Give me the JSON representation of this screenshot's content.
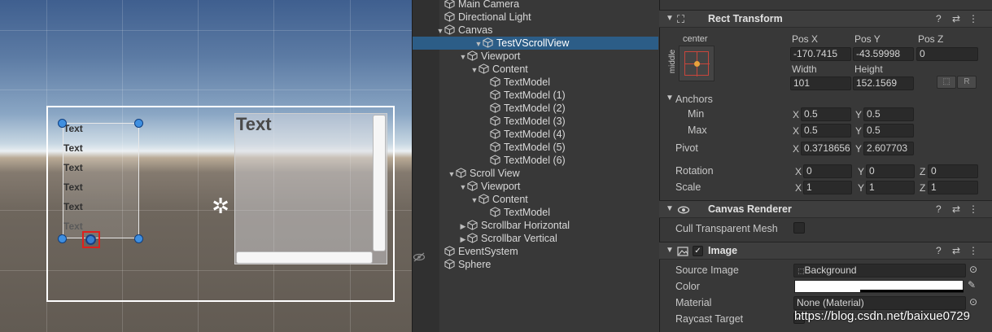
{
  "scene": {
    "sv1_texts": [
      "Text",
      "Text",
      "Text",
      "Text",
      "Text",
      "Text"
    ],
    "sv2_title": "Text"
  },
  "hierarchy": {
    "items": [
      {
        "label": "Main Camera",
        "arrow": ""
      },
      {
        "label": "Directional Light",
        "arrow": ""
      },
      {
        "label": "Canvas",
        "arrow": "▼"
      },
      {
        "label": "TestVScrollView",
        "arrow": "▼",
        "selected": true
      },
      {
        "label": "Viewport",
        "arrow": "▼"
      },
      {
        "label": "Content",
        "arrow": "▼"
      },
      {
        "label": "TextModel",
        "arrow": ""
      },
      {
        "label": "TextModel (1)",
        "arrow": ""
      },
      {
        "label": "TextModel (2)",
        "arrow": ""
      },
      {
        "label": "TextModel (3)",
        "arrow": ""
      },
      {
        "label": "TextModel (4)",
        "arrow": ""
      },
      {
        "label": "TextModel (5)",
        "arrow": ""
      },
      {
        "label": "TextModel (6)",
        "arrow": ""
      },
      {
        "label": "Scroll View",
        "arrow": "▼"
      },
      {
        "label": "Viewport",
        "arrow": "▼"
      },
      {
        "label": "Content",
        "arrow": "▼"
      },
      {
        "label": "TextModel",
        "arrow": ""
      },
      {
        "label": "Scrollbar Horizontal",
        "arrow": "▶"
      },
      {
        "label": "Scrollbar Vertical",
        "arrow": "▶"
      },
      {
        "label": "EventSystem",
        "arrow": ""
      },
      {
        "label": "Sphere",
        "arrow": ""
      }
    ]
  },
  "inspector": {
    "rect_transform": {
      "title": "Rect Transform",
      "anchor_preset_top": "center",
      "anchor_preset_side": "middle",
      "pos_x_label": "Pos X",
      "pos_y_label": "Pos Y",
      "pos_z_label": "Pos Z",
      "pos_x": "-170.7415",
      "pos_y": "-43.59998",
      "pos_z": "0",
      "width_label": "Width",
      "height_label": "Height",
      "width": "101",
      "height": "152.1569",
      "raw_btn": "R",
      "anchors_label": "Anchors",
      "min_label": "Min",
      "max_label": "Max",
      "x_label": "X",
      "y_label": "Y",
      "z_label": "Z",
      "min_x": "0.5",
      "min_y": "0.5",
      "max_x": "0.5",
      "max_y": "0.5",
      "pivot_label": "Pivot",
      "pivot_x": "0.3718656",
      "pivot_y": "2.607703",
      "rotation_label": "Rotation",
      "rot_x": "0",
      "rot_y": "0",
      "rot_z": "0",
      "scale_label": "Scale",
      "scale_x": "1",
      "scale_y": "1",
      "scale_z": "1"
    },
    "canvas_renderer": {
      "title": "Canvas Renderer",
      "cull_label": "Cull Transparent Mesh"
    },
    "image": {
      "title": "Image",
      "source_label": "Source Image",
      "source_value": "Background",
      "color_label": "Color",
      "color_value": "#ffffff",
      "material_label": "Material",
      "material_value": "None (Material)",
      "raycast_label": "Raycast Target"
    },
    "header_buttons": {
      "help": "?",
      "settings": "⇄",
      "menu": "⋮"
    },
    "check_glyph": "✓",
    "watermark": "https://blog.csdn.net/baixue0729"
  },
  "icons": {
    "cube": "cube-icon",
    "eye_off": "eye-off-icon",
    "light": "directional-light-icon"
  }
}
